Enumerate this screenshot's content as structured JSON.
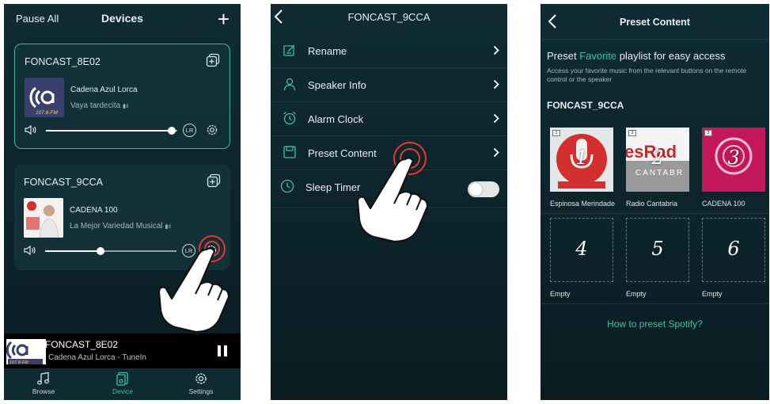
{
  "screen1": {
    "header": {
      "left_label": "Pause All",
      "title": "Devices"
    },
    "cards": [
      {
        "name": "FONCAST_8E02",
        "station": "Cadena Azul Lorca",
        "subtitle": "Vaya tardecita",
        "lr": "LR",
        "volume": 0.96,
        "selected": true
      },
      {
        "name": "FONCAST_9CCA",
        "station": "CADENA 100",
        "subtitle": "La Mejor Variedad Musical",
        "lr": "LR",
        "volume": 0.42,
        "selected": false
      }
    ],
    "logo": {
      "freq": "107.8-FM"
    },
    "now_playing": {
      "title": "FONCAST_8E02",
      "subtitle": "Cadena Azul Lorca - TuneIn"
    },
    "tabs": [
      {
        "label": "Browse",
        "icon": "music-note-icon",
        "active": false
      },
      {
        "label": "Device",
        "icon": "device-icon",
        "active": true
      },
      {
        "label": "Settings",
        "icon": "gear-icon",
        "active": false
      }
    ]
  },
  "screen2": {
    "title": "FONCAST_9CCA",
    "menu": [
      {
        "label": "Rename",
        "icon": "rename-icon"
      },
      {
        "label": "Speaker Info",
        "icon": "person-icon"
      },
      {
        "label": "Alarm Clock",
        "icon": "alarm-clock-icon"
      },
      {
        "label": "Preset Content",
        "icon": "save-icon"
      },
      {
        "label": "Sleep Timer",
        "icon": "sleep-timer-icon",
        "toggle": false
      }
    ]
  },
  "screen3": {
    "title": "Preset Content",
    "headline_pre": "Preset",
    "headline_accent": "Favorite",
    "headline_post": "playlist for easy access",
    "description": "Access your favorite music from the relevant buttons on the remote control or the speaker",
    "device": "FONCAST_9CCA",
    "presets": [
      {
        "num": "1",
        "label": "Espinosa Merindades",
        "filled": true,
        "badge": "1"
      },
      {
        "num": "2",
        "label": "Radio Cantabria",
        "filled": true,
        "badge": "2",
        "art_text": "esRad",
        "art_sub": "CANTABR"
      },
      {
        "num": "3",
        "label": "CADENA 100",
        "filled": true,
        "badge": "3"
      },
      {
        "num": "4",
        "label": "Empty",
        "filled": false
      },
      {
        "num": "5",
        "label": "Empty",
        "filled": false
      },
      {
        "num": "6",
        "label": "Empty",
        "filled": false
      }
    ],
    "link": "How to preset Spotify?"
  },
  "colors": {
    "accent": "#3fc19f",
    "background": "#0d252c",
    "touch_ripple": "#e53935"
  }
}
